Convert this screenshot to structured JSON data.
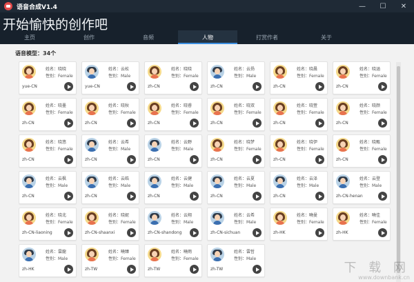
{
  "window": {
    "title": "语音合成V1.4",
    "controls": [
      "—",
      "☐",
      "✕"
    ]
  },
  "header": {
    "headline": "开始愉快的创作吧"
  },
  "nav": {
    "tabs": [
      {
        "label": "主页",
        "active": false
      },
      {
        "label": "创作",
        "active": false
      },
      {
        "label": "音频",
        "active": false
      },
      {
        "label": "人物",
        "active": true
      },
      {
        "label": "打赏作者",
        "active": false
      },
      {
        "label": "关于",
        "active": false
      }
    ]
  },
  "voices": {
    "count_label": "语音模型：34个",
    "items": [
      {
        "name": "姓名：晓晓",
        "gender": "性别：Female",
        "code": "yue-CN",
        "avatar": "female"
      },
      {
        "name": "姓名：云松",
        "gender": "性别：Male",
        "code": "yue-CN",
        "avatar": "male"
      },
      {
        "name": "姓名：晓晓",
        "gender": "性别：Female",
        "code": "zh-CN",
        "avatar": "female"
      },
      {
        "name": "姓名：云扬",
        "gender": "性别：Male",
        "code": "zh-CN",
        "avatar": "male"
      },
      {
        "name": "姓名：晓晨",
        "gender": "性别：Female",
        "code": "zh-CN",
        "avatar": "female"
      },
      {
        "name": "姓名：晓涵",
        "gender": "性别：Female",
        "code": "zh-CN",
        "avatar": "female"
      },
      {
        "name": "姓名：晓墨",
        "gender": "性别：Female",
        "code": "zh-CN",
        "avatar": "female"
      },
      {
        "name": "姓名：晓秋",
        "gender": "性别：Female",
        "code": "zh-CN",
        "avatar": "female"
      },
      {
        "name": "姓名：晓睿",
        "gender": "性别：Female",
        "code": "zh-CN",
        "avatar": "female"
      },
      {
        "name": "姓名：晓双",
        "gender": "性别：Female",
        "code": "zh-CN",
        "avatar": "female"
      },
      {
        "name": "姓名：晓萱",
        "gender": "性别：Female",
        "code": "zh-CN",
        "avatar": "female"
      },
      {
        "name": "姓名：晓颜",
        "gender": "性别：Female",
        "code": "zh-CN",
        "avatar": "female"
      },
      {
        "name": "姓名：晓悠",
        "gender": "性别：Female",
        "code": "zh-CN",
        "avatar": "female"
      },
      {
        "name": "姓名：云希",
        "gender": "性别：Male",
        "code": "zh-CN",
        "avatar": "male"
      },
      {
        "name": "姓名：云野",
        "gender": "性别：Male",
        "code": "zh-CN",
        "avatar": "male"
      },
      {
        "name": "姓名：晓梦",
        "gender": "性别：Female",
        "code": "zh-CN",
        "avatar": "female"
      },
      {
        "name": "姓名：晓伊",
        "gender": "性别：Female",
        "code": "zh-CN",
        "avatar": "female"
      },
      {
        "name": "姓名：晓甄",
        "gender": "性别：Female",
        "code": "zh-CN",
        "avatar": "female"
      },
      {
        "name": "姓名：云枫",
        "gender": "性别：Male",
        "code": "zh-CN",
        "avatar": "male"
      },
      {
        "name": "姓名：云皓",
        "gender": "性别：Male",
        "code": "zh-CN",
        "avatar": "male"
      },
      {
        "name": "姓名：云健",
        "gender": "性别：Male",
        "code": "zh-CN",
        "avatar": "male"
      },
      {
        "name": "姓名：云夏",
        "gender": "性别：Male",
        "code": "zh-CN",
        "avatar": "male"
      },
      {
        "name": "姓名：云泽",
        "gender": "性别：Male",
        "code": "zh-CN",
        "avatar": "male"
      },
      {
        "name": "姓名：云登",
        "gender": "性别：Male",
        "code": "zh-CN-henan",
        "avatar": "male"
      },
      {
        "name": "姓名：晓北",
        "gender": "性别：Female",
        "code": "zh-CN-liaoning",
        "avatar": "female"
      },
      {
        "name": "姓名：晓妮",
        "gender": "性别：Female",
        "code": "zh-CN-shaanxi",
        "avatar": "female"
      },
      {
        "name": "姓名：云翔",
        "gender": "性别：Male",
        "code": "zh-CN-shandong",
        "avatar": "male"
      },
      {
        "name": "姓名：云希",
        "gender": "性别：Male",
        "code": "zh-CN-sichuan",
        "avatar": "male"
      },
      {
        "name": "姓名：曉曼",
        "gender": "性别：Female",
        "code": "zh-HK",
        "avatar": "female"
      },
      {
        "name": "姓名：曉佳",
        "gender": "性别：Female",
        "code": "zh-HK",
        "avatar": "female"
      },
      {
        "name": "姓名：雲龍",
        "gender": "性别：Male",
        "code": "zh-HK",
        "avatar": "male"
      },
      {
        "name": "姓名：曉臻",
        "gender": "性别：Female",
        "code": "zh-TW",
        "avatar": "female"
      },
      {
        "name": "姓名：曉雨",
        "gender": "性别：Female",
        "code": "zh-TW",
        "avatar": "female"
      },
      {
        "name": "姓名：雲哲",
        "gender": "性别：Male",
        "code": "zh-TW",
        "avatar": "male"
      }
    ]
  },
  "watermark": {
    "text": "下 载 网",
    "url": "www.downbank.cn"
  },
  "colors": {
    "titlebar": "#1f2a36",
    "header": "#17212c",
    "active_tab": "#243240",
    "accent": "#3b8ee0",
    "app_icon": "#e34b4b"
  }
}
